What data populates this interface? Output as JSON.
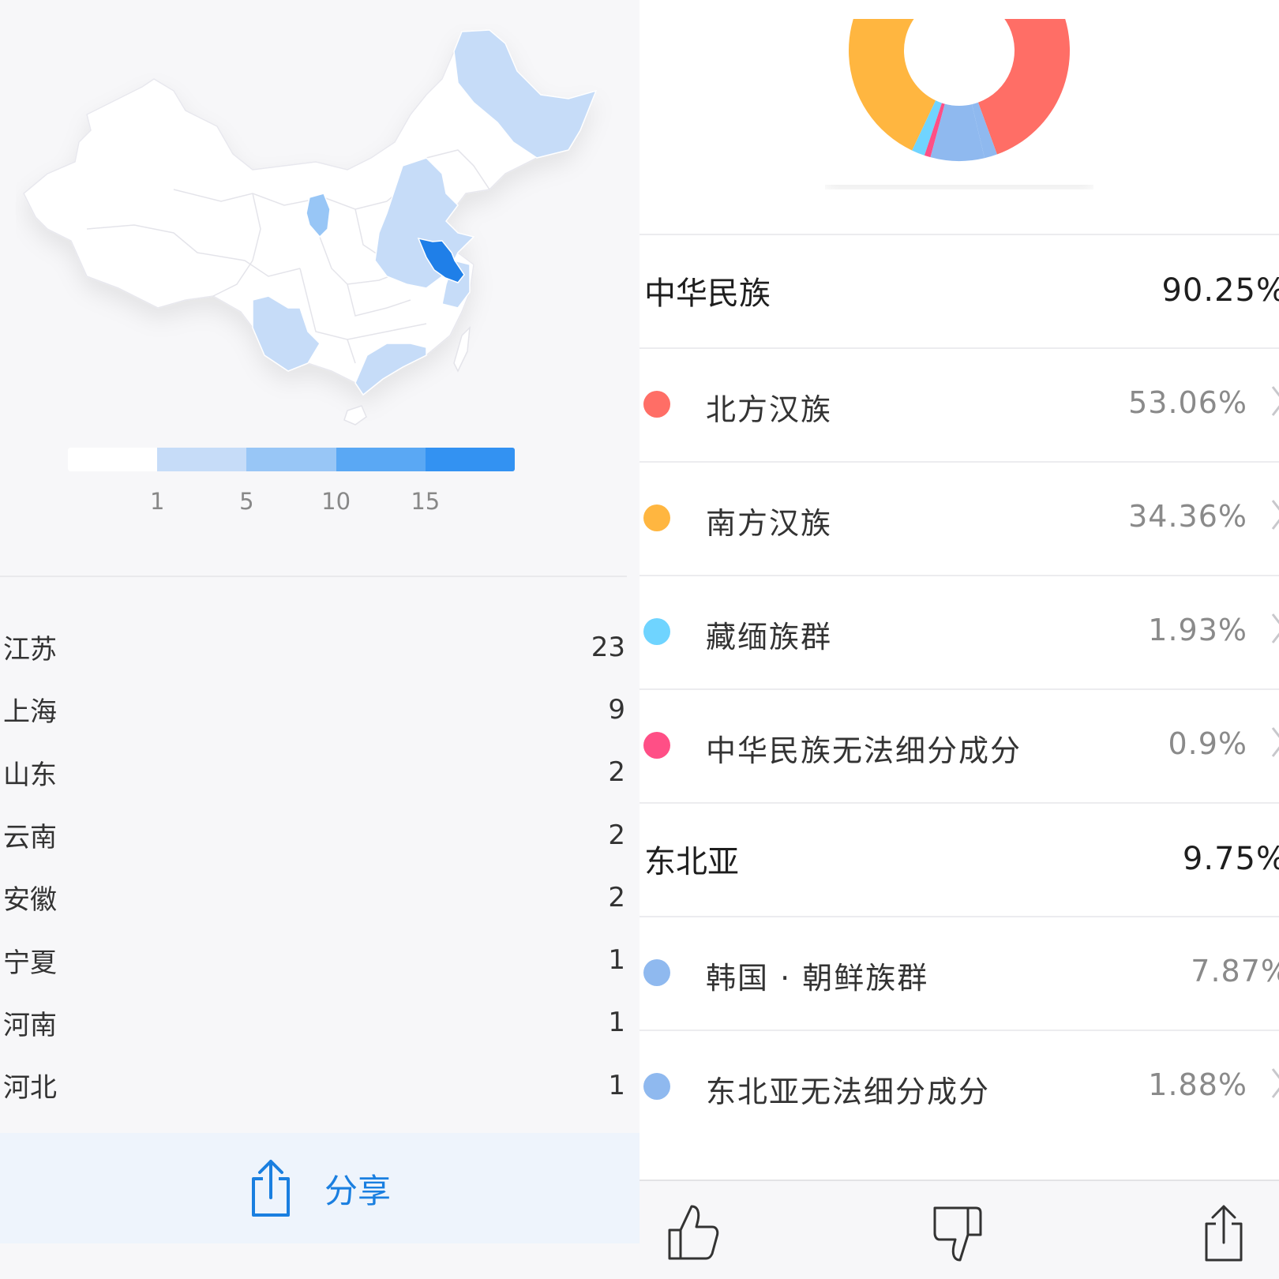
{
  "colors": {
    "map_empty": "#ffffff",
    "map_low": "#c6dcf8",
    "map_mid": "#98c6f6",
    "map_high": "#3c95f2",
    "map_top": "#1f7fe8",
    "accent": "#1a7fe0",
    "north_han": "#ff6e66",
    "south_han": "#ffb640",
    "tibeto_burman": "#6fd4ff",
    "unclassified": "#ff4f86",
    "northeast_asia": "#8fb9ef"
  },
  "map": {
    "legend_ticks": [
      "1",
      "5",
      "10",
      "15"
    ]
  },
  "provinces": [
    {
      "name": "江苏",
      "value": "23"
    },
    {
      "name": "上海",
      "value": "9"
    },
    {
      "name": "山东",
      "value": "2"
    },
    {
      "name": "云南",
      "value": "2"
    },
    {
      "name": "安徽",
      "value": "2"
    },
    {
      "name": "宁夏",
      "value": "1"
    },
    {
      "name": "河南",
      "value": "1"
    },
    {
      "name": "河北",
      "value": "1"
    }
  ],
  "share": {
    "label": "分享"
  },
  "donut": {
    "type": "pie",
    "values": [
      53.06,
      34.36,
      1.93,
      0.9,
      7.87,
      1.88
    ]
  },
  "groups": [
    {
      "name": "中华民族",
      "value": "90.25%",
      "items": [
        {
          "name": "北方汉族",
          "value": "53.06%"
        },
        {
          "name": "南方汉族",
          "value": "34.36%"
        },
        {
          "name": "藏缅族群",
          "value": "1.93%"
        },
        {
          "name": "中华民族无法细分成分",
          "value": "0.9%"
        }
      ]
    },
    {
      "name": "东北亚",
      "value": "9.75%",
      "items": [
        {
          "name": "韩国 · 朝鲜族群",
          "value": "7.87%"
        },
        {
          "name": "东北亚无法细分成分",
          "value": "1.88%"
        }
      ]
    }
  ],
  "toolbar": {
    "icons": [
      "thumbs-up-icon",
      "thumbs-down-icon",
      "share-icon"
    ]
  }
}
